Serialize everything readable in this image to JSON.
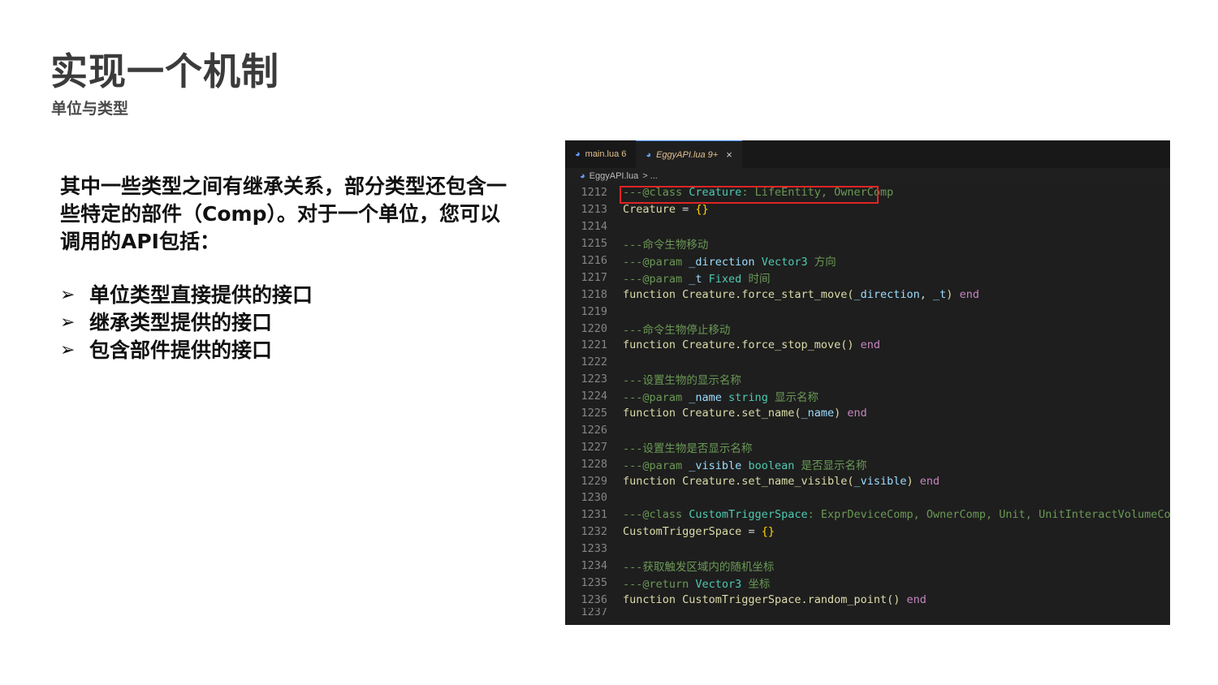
{
  "slide": {
    "title": "实现一个机制",
    "subtitle": "单位与类型",
    "intro": "其中一些类型之间有继承关系，部分类型还包含一些特定的部件（Comp）。对于一个单位，您可以调用的API包括：",
    "bullet_marker": "➢",
    "bullets": [
      "单位类型直接提供的接口",
      "继承类型提供的接口",
      "包含部件提供的接口"
    ]
  },
  "editor": {
    "tabs": [
      {
        "label": "main.lua 6",
        "icon": "lua-file-icon",
        "active": false
      },
      {
        "label": "EggyAPI.lua 9+",
        "icon": "lua-file-icon",
        "active": true,
        "close": "×"
      }
    ],
    "breadcrumb": {
      "file": "EggyAPI.lua",
      "separator": "> ..."
    },
    "lines": [
      {
        "n": "1212",
        "parts": [
          [
            "---@class ",
            "comment"
          ],
          [
            "Creature",
            "type"
          ],
          [
            ": LifeEntity, OwnerComp",
            "comment"
          ]
        ]
      },
      {
        "n": "1213",
        "parts": [
          [
            "Creature",
            "kw"
          ],
          [
            " = ",
            "plain"
          ],
          [
            "{}",
            "brace"
          ]
        ]
      },
      {
        "n": "1214",
        "parts": []
      },
      {
        "n": "1215",
        "parts": [
          [
            "---命令生物移动",
            "comment"
          ]
        ]
      },
      {
        "n": "1216",
        "parts": [
          [
            "---@param ",
            "comment"
          ],
          [
            "_direction",
            "param"
          ],
          [
            " Vector3 ",
            "type"
          ],
          [
            "方向",
            "comment"
          ]
        ]
      },
      {
        "n": "1217",
        "parts": [
          [
            "---@param ",
            "comment"
          ],
          [
            "_t",
            "param"
          ],
          [
            " Fixed ",
            "type"
          ],
          [
            "时间",
            "comment"
          ]
        ]
      },
      {
        "n": "1218",
        "parts": [
          [
            "function ",
            "kw"
          ],
          [
            "Creature.force_start_move(",
            "fn"
          ],
          [
            "_direction",
            "param"
          ],
          [
            ", ",
            "plain"
          ],
          [
            "_t",
            "param"
          ],
          [
            ")",
            "fn"
          ],
          [
            " end",
            "end"
          ]
        ]
      },
      {
        "n": "1219",
        "parts": []
      },
      {
        "n": "1220",
        "parts": [
          [
            "---命令生物停止移动",
            "comment"
          ]
        ]
      },
      {
        "n": "1221",
        "parts": [
          [
            "function ",
            "kw"
          ],
          [
            "Creature.force_stop_move()",
            "fn"
          ],
          [
            " end",
            "end"
          ]
        ]
      },
      {
        "n": "1222",
        "parts": []
      },
      {
        "n": "1223",
        "parts": [
          [
            "---设置生物的显示名称",
            "comment"
          ]
        ]
      },
      {
        "n": "1224",
        "parts": [
          [
            "---@param ",
            "comment"
          ],
          [
            "_name",
            "param"
          ],
          [
            " string ",
            "type"
          ],
          [
            "显示名称",
            "comment"
          ]
        ]
      },
      {
        "n": "1225",
        "parts": [
          [
            "function ",
            "kw"
          ],
          [
            "Creature.set_name(",
            "fn"
          ],
          [
            "_name",
            "param"
          ],
          [
            ")",
            "fn"
          ],
          [
            " end",
            "end"
          ]
        ]
      },
      {
        "n": "1226",
        "parts": []
      },
      {
        "n": "1227",
        "parts": [
          [
            "---设置生物是否显示名称",
            "comment"
          ]
        ]
      },
      {
        "n": "1228",
        "parts": [
          [
            "---@param ",
            "comment"
          ],
          [
            "_visible",
            "param"
          ],
          [
            " boolean ",
            "type"
          ],
          [
            "是否显示名称",
            "comment"
          ]
        ]
      },
      {
        "n": "1229",
        "parts": [
          [
            "function ",
            "kw"
          ],
          [
            "Creature.set_name_visible(",
            "fn"
          ],
          [
            "_visible",
            "param"
          ],
          [
            ")",
            "fn"
          ],
          [
            " end",
            "end"
          ]
        ]
      },
      {
        "n": "1230",
        "parts": []
      },
      {
        "n": "1231",
        "parts": [
          [
            "---@class ",
            "comment"
          ],
          [
            "CustomTriggerSpace",
            "type"
          ],
          [
            ": ExprDeviceComp, OwnerComp, Unit, UnitInteractVolumeComp",
            "comment"
          ]
        ]
      },
      {
        "n": "1232",
        "parts": [
          [
            "CustomTriggerSpace",
            "kw"
          ],
          [
            " = ",
            "plain"
          ],
          [
            "{}",
            "brace"
          ]
        ]
      },
      {
        "n": "1233",
        "parts": []
      },
      {
        "n": "1234",
        "parts": [
          [
            "---获取触发区域内的随机坐标",
            "comment"
          ]
        ]
      },
      {
        "n": "1235",
        "parts": [
          [
            "---@return ",
            "comment"
          ],
          [
            "Vector3 ",
            "type"
          ],
          [
            "坐标",
            "comment"
          ]
        ]
      },
      {
        "n": "1236",
        "parts": [
          [
            "function ",
            "kw"
          ],
          [
            "CustomTriggerSpace.random_point()",
            "fn"
          ],
          [
            " end",
            "end"
          ]
        ]
      },
      {
        "n": "1237",
        "parts": [],
        "partial": true
      }
    ]
  },
  "colors": {
    "highlight_border": "#e02424",
    "editor_bg": "#1e1e1e",
    "comment": "#6a9955",
    "type": "#4ec9b0",
    "param": "#9cdcfe"
  }
}
